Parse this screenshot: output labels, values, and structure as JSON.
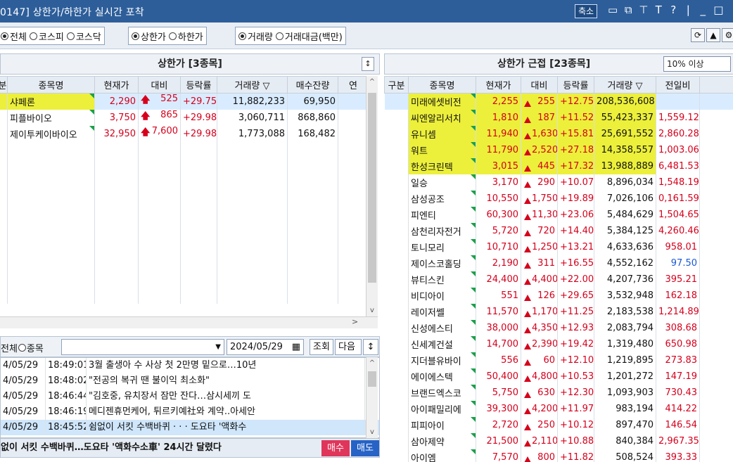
{
  "window": {
    "title": "0147] 상한가/하한가 실시간 포착",
    "shrink_label": "축소",
    "icons": [
      "window-icon",
      "copy-icon",
      "pin-icon",
      "font-icon",
      "help-icon",
      "separator",
      "minimize-icon",
      "maximize-icon"
    ]
  },
  "toolbar": {
    "market": {
      "options": [
        "전체",
        "코스피",
        "코스닥"
      ],
      "selected": "전체"
    },
    "limit": {
      "options": [
        "상한가",
        "하한가"
      ],
      "selected": "상한가"
    },
    "sort": {
      "options": [
        "거래량",
        "거래대금(백만)"
      ],
      "selected": "거래량"
    },
    "refresh_icon": "refresh-icon",
    "up_icon": "triangle-up-icon"
  },
  "left_panel": {
    "title": "상한가 [3종목]",
    "columns": [
      "분",
      "종목명",
      "현재가",
      "대비",
      "등락률",
      "거래량 ▽",
      "매수잔량",
      "연"
    ],
    "rows": [
      {
        "name": "샤페론",
        "price": "2,290",
        "change": "525",
        "rate": "+29.75",
        "volume": "11,882,233",
        "bid": "69,950"
      },
      {
        "name": "피플바이오",
        "price": "3,750",
        "change": "865",
        "rate": "+29.98",
        "volume": "3,060,711",
        "bid": "868,860"
      },
      {
        "name": "제이투케이바이오",
        "price": "32,950",
        "change": "7,600",
        "rate": "+29.98",
        "volume": "1,773,088",
        "bid": "168,482"
      }
    ]
  },
  "news": {
    "filter_all": "전체",
    "filter_stock": "종목",
    "date": "2024/05/29",
    "search_btn": "조회",
    "next_btn": "다음",
    "items": [
      {
        "date": "4/05/29",
        "time": "18:49:01",
        "headline": "3월 출생아 수 사상 첫 2만명 밑으로…10년"
      },
      {
        "date": "4/05/29",
        "time": "18:48:02",
        "headline": "\"전공의 복귀 땐 불이익 최소화\""
      },
      {
        "date": "4/05/29",
        "time": "18:46:44",
        "headline": "\"김호중, 유치장서 잠만 잔다…삼시세끼 도"
      },
      {
        "date": "4/05/29",
        "time": "18:46:19",
        "headline": "메디젠휴먼케어, 튀르키예社와 계약..아세안"
      },
      {
        "date": "4/05/29",
        "time": "18:45:52",
        "headline": "쉼없이 서킷 수백바퀴 · · · 도요타 '액화수"
      }
    ],
    "footer": "없이 서킷 수백바퀴…도요타 '액화수소車' 24시간 달렸다",
    "buy": "매수",
    "sell": "매도"
  },
  "right_panel": {
    "title": "상한가 근접 [23종목]",
    "threshold": "10% 이상",
    "columns": [
      "구분",
      "종목명",
      "현재가",
      "대비",
      "등락률",
      "거래량 ▽",
      "전일비"
    ],
    "rows": [
      {
        "name": "미래에셋비전",
        "price": "2,255",
        "change": "255",
        "rate": "+12.75",
        "volume": "208,536,608",
        "prev": ""
      },
      {
        "name": "씨엔알리서치",
        "price": "1,810",
        "change": "187",
        "rate": "+11.52",
        "volume": "55,423,337",
        "prev": "1,559.12"
      },
      {
        "name": "유니셈",
        "price": "11,940",
        "change": "1,630",
        "rate": "+15.81",
        "volume": "25,691,552",
        "prev": "2,860.28"
      },
      {
        "name": "워트",
        "price": "11,790",
        "change": "2,520",
        "rate": "+27.18",
        "volume": "14,358,557",
        "prev": "1,003.06"
      },
      {
        "name": "한성크린텍",
        "price": "3,015",
        "change": "445",
        "rate": "+17.32",
        "volume": "13,988,889",
        "prev": "6,481.53"
      },
      {
        "name": "일승",
        "price": "3,170",
        "change": "290",
        "rate": "+10.07",
        "volume": "8,896,034",
        "prev": "1,548.19"
      },
      {
        "name": "삼성공조",
        "price": "10,550",
        "change": "1,750",
        "rate": "+19.89",
        "volume": "7,026,106",
        "prev": "0,161.59"
      },
      {
        "name": "피엔티",
        "price": "60,300",
        "change": "11,300",
        "rate": "+23.06",
        "volume": "5,484,629",
        "prev": "1,504.65"
      },
      {
        "name": "삼천리자전거",
        "price": "5,720",
        "change": "720",
        "rate": "+14.40",
        "volume": "5,384,125",
        "prev": "4,260.46"
      },
      {
        "name": "토니모리",
        "price": "10,710",
        "change": "1,250",
        "rate": "+13.21",
        "volume": "4,633,636",
        "prev": "958.01"
      },
      {
        "name": "제이스코홀딩",
        "price": "2,190",
        "change": "311",
        "rate": "+16.55",
        "volume": "4,552,162",
        "prev": "97.50"
      },
      {
        "name": "뷰티스킨",
        "price": "24,400",
        "change": "4,400",
        "rate": "+22.00",
        "volume": "4,207,736",
        "prev": "395.21"
      },
      {
        "name": "비디아이",
        "price": "551",
        "change": "126",
        "rate": "+29.65",
        "volume": "3,532,948",
        "prev": "162.18"
      },
      {
        "name": "레이저쎌",
        "price": "11,570",
        "change": "1,170",
        "rate": "+11.25",
        "volume": "2,183,538",
        "prev": "1,214.89"
      },
      {
        "name": "신성에스티",
        "price": "38,000",
        "change": "4,350",
        "rate": "+12.93",
        "volume": "2,083,794",
        "prev": "308.68"
      },
      {
        "name": "신세계건설",
        "price": "14,700",
        "change": "2,390",
        "rate": "+19.42",
        "volume": "1,319,480",
        "prev": "650.98"
      },
      {
        "name": "지더블유바이",
        "price": "556",
        "change": "60",
        "rate": "+12.10",
        "volume": "1,219,895",
        "prev": "273.83"
      },
      {
        "name": "에이에스텍",
        "price": "50,400",
        "change": "4,800",
        "rate": "+10.53",
        "volume": "1,201,272",
        "prev": "147.19"
      },
      {
        "name": "브랜드엑스코",
        "price": "5,750",
        "change": "630",
        "rate": "+12.30",
        "volume": "1,093,903",
        "prev": "730.43"
      },
      {
        "name": "아이패밀리에",
        "price": "39,300",
        "change": "4,200",
        "rate": "+11.97",
        "volume": "983,194",
        "prev": "414.22"
      },
      {
        "name": "피피아이",
        "price": "2,720",
        "change": "250",
        "rate": "+10.12",
        "volume": "897,470",
        "prev": "146.54"
      },
      {
        "name": "삼아제약",
        "price": "21,500",
        "change": "2,110",
        "rate": "+10.88",
        "volume": "840,384",
        "prev": "2,967.35"
      },
      {
        "name": "아이엠",
        "price": "7,570",
        "change": "800",
        "rate": "+11.82",
        "volume": "508,524",
        "prev": "393.33"
      }
    ]
  },
  "colors": {
    "up": "#d6001c",
    "down": "#1a57d6",
    "highlight": "#ecf03a",
    "title_bar": "#2d5e9a",
    "buy": "#e0355a",
    "sell": "#2763c6"
  }
}
